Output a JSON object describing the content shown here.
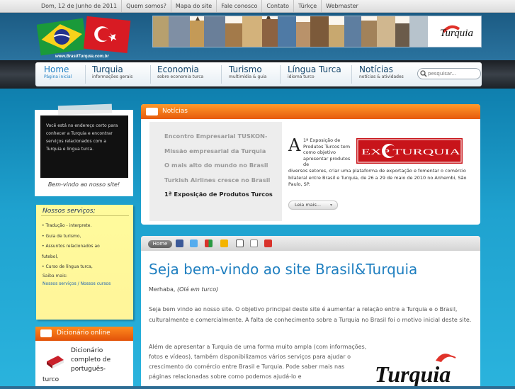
{
  "topbar": {
    "links": [
      "Dom, 12 de Junho de 2011",
      "Quem somos?",
      "Mapa do site",
      "Fale conosco",
      "Contato",
      "Türkçe",
      "Webmaster"
    ]
  },
  "header": {
    "logo_text": "www.BrasilTurquia.com.br",
    "banner_brand": "Turquia"
  },
  "nav": {
    "items": [
      {
        "title": "Home",
        "sub": "Página inicial",
        "active": true
      },
      {
        "title": "Turquia",
        "sub": "informações gerais"
      },
      {
        "title": "Economia",
        "sub": "sobre economia turca"
      },
      {
        "title": "Turismo",
        "sub": "multimídia & guia"
      },
      {
        "title": "Língua Turca",
        "sub": "idioma turco"
      },
      {
        "title": "Notícias",
        "sub": "notícias & atividades"
      }
    ],
    "search_placeholder": "pesquisar..."
  },
  "sidebar": {
    "note_text": "Você está no endereço certo para conhecer a Turquia e encontrar serviços relacionados com a Turquia e língua turca.",
    "welcome": "Bem-vindo ao nosso site!",
    "services_title": "Nossos serviços;",
    "services": [
      "• Tradução - interprete.",
      "• Guia de turismo,",
      "• Assuntos relacionados ao",
      "futebol,",
      "• Curso de língua turca,"
    ],
    "saiba_label": "Saiba mais:",
    "services_link": "Nossos serviços",
    "link_sep": "/",
    "courses_link": "Nossos cursos",
    "dictionary_title": "Dicionário online",
    "dictionary_text": "Dicionário completo de português-",
    "dictionary_text2": "turco"
  },
  "news": {
    "title": "Notícias",
    "items": [
      "Encontro Empresarial TUSKON-",
      "Missão empresarial da Turquia",
      "O mais alto do mundo no Brasil",
      "Turkish Airlines cresce no Brasil",
      "1ª Exposição de Produtos Turcos"
    ],
    "selected_index": 4,
    "drop_cap": "A",
    "body_first": "1ª Exposição de Produtos Turcos tem como objetivo apresentar produtos de",
    "body_rest": "diversos setores, criar uma plataforma de exportação e fomentar o comércio bilateral entre Brasil e Turquia, de 26 a 29 de maio de 2010 no Anhembi, São Paulo, SP.",
    "image_text": "EXP TURQUIA",
    "read_more": "Leia mais..."
  },
  "content": {
    "home_label": "Home",
    "title": "Seja bem-vindo ao site Brasil&Turquia",
    "greeting": "Merhaba,",
    "greeting_note": "(Olá em turco)",
    "paragraph1": "Seja bem vindo ao nosso site. O objetivo principal deste site é aumentar a relação entre a Turquia e o Brasil, culturalmente e comercialmente. A falta de conhecimento sobre a Turquia no Brasil foi o motivo inicial deste site.",
    "paragraph2": "Além de apresentar a Turquia de uma forma muito ampla (com informações, fotos e vídeos), também disponibilizamos vários serviços para ajudar o crescimento do comércio entre Brasil e Turquia. Pode saber mais nas páginas relacionadas sobre como podemos ajudá-lo e",
    "logo_text": "Turquia"
  },
  "colors": {
    "accent": "#1f7fc0",
    "orange": "#ef6d12",
    "nav_text": "#14456a"
  }
}
